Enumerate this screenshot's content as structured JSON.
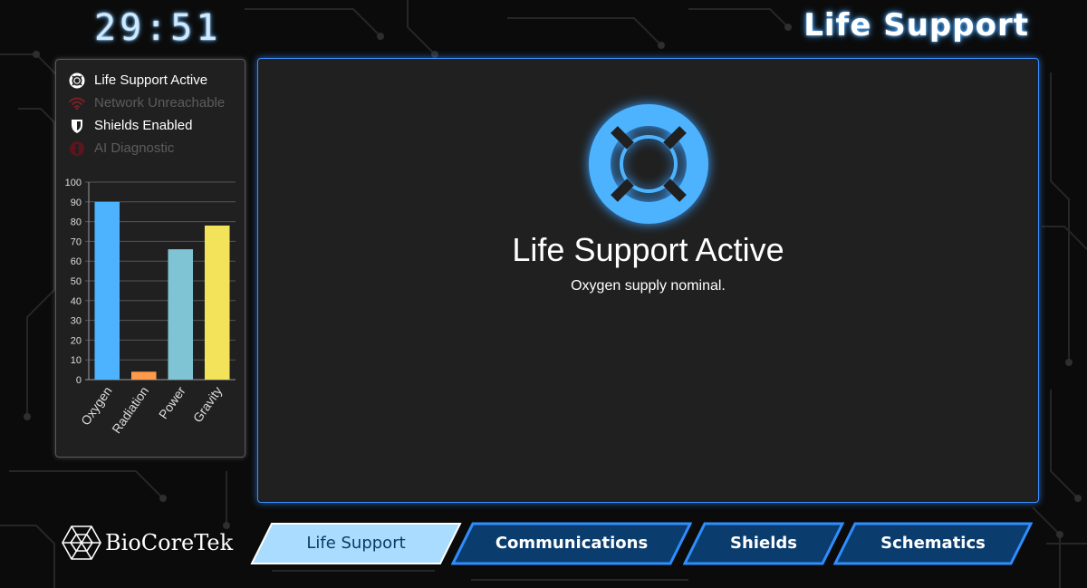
{
  "clock": "29:51",
  "page_title": "Life Support",
  "status_items": [
    {
      "label": "Life Support Active",
      "state": "on",
      "icon": "lifebuoy-icon"
    },
    {
      "label": "Network Unreachable",
      "state": "off",
      "icon": "wifi-icon"
    },
    {
      "label": "Shields Enabled",
      "state": "on",
      "icon": "shield-icon"
    },
    {
      "label": "AI Diagnostic",
      "state": "off",
      "icon": "ai-robot-icon"
    }
  ],
  "chart_data": {
    "type": "bar",
    "categories": [
      "Oxygen",
      "Radiation",
      "Power",
      "Gravity"
    ],
    "values": [
      90,
      4,
      66,
      78
    ],
    "colors": [
      "#4db3ff",
      "#ff9a4a",
      "#7fc4d4",
      "#f2e35a"
    ],
    "yticks": [
      "0",
      "10",
      "20",
      "30",
      "40",
      "50",
      "60",
      "70",
      "80",
      "90",
      "100"
    ],
    "ylim": [
      0,
      100
    ],
    "grid": true
  },
  "main": {
    "title": "Life Support Active",
    "subtitle": "Oxygen supply nominal.",
    "icon": "lifebuoy-icon"
  },
  "brand": {
    "name": "BioCoreTek",
    "icon": "hexagon-logo-icon"
  },
  "tabs": [
    {
      "label": "Life Support",
      "active": true
    },
    {
      "label": "Communications",
      "active": false
    },
    {
      "label": "Shields",
      "active": false
    },
    {
      "label": "Schematics",
      "active": false
    }
  ],
  "colors": {
    "accent": "#3a8fff",
    "active_tab": "#a9dcff",
    "inactive_tab": "#0a3d6e",
    "icon_blue": "#4db3ff",
    "status_off": "#7a1f26"
  }
}
